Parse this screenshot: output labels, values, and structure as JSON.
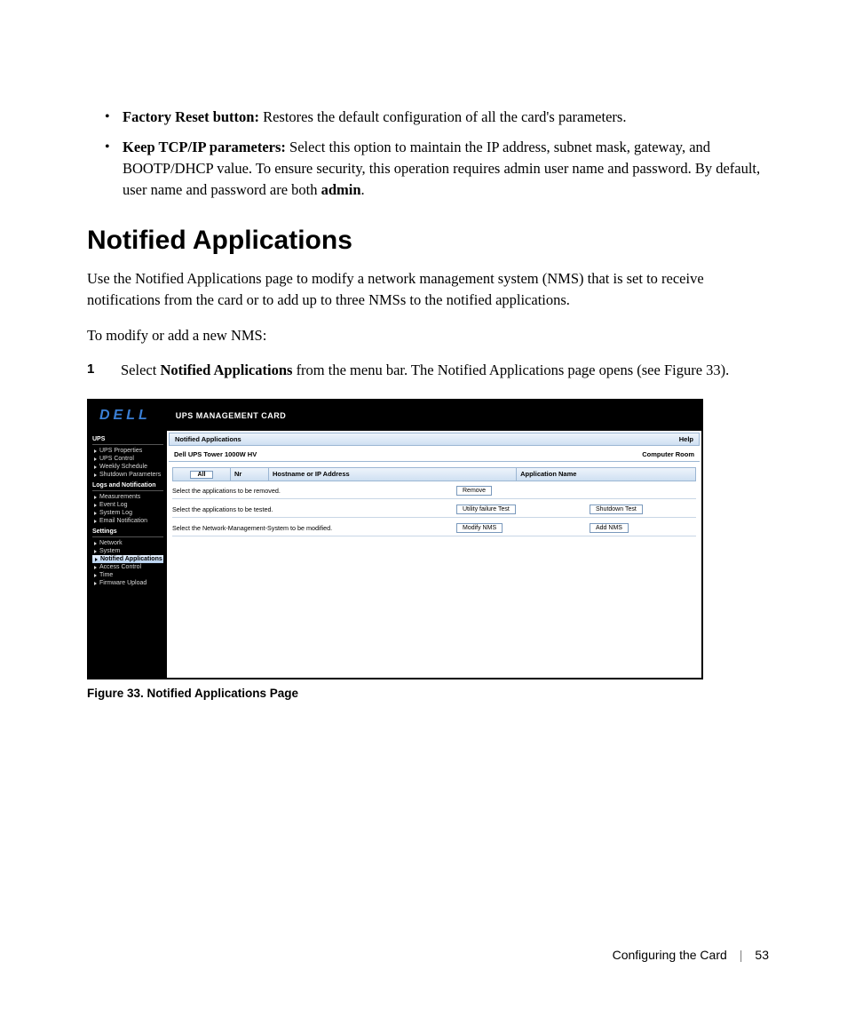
{
  "bullets": [
    {
      "label": "Factory Reset button:",
      "text": " Restores the default configuration of all the card's parameters."
    },
    {
      "label": "Keep TCP/IP parameters:",
      "text": " Select this option to maintain the IP address, subnet mask, gateway, and BOOTP/DHCP value. To ensure security, this operation requires admin user name and password. By default, user name and password are both ",
      "tail_bold": "admin",
      "tail_after": "."
    }
  ],
  "section_title": "Notified Applications",
  "para1": "Use the Notified Applications page to modify a network management system (NMS) that is set to receive notifications from the card or to add up to three NMSs to the notified applications.",
  "para2": "To modify or add a new NMS:",
  "step": {
    "num": "1",
    "pre": "Select ",
    "bold": "Notified Applications",
    "post": " from the menu bar. The Notified Applications page opens (see Figure 33)."
  },
  "figure": {
    "logo": "DELL",
    "header": "UPS MANAGEMENT CARD",
    "sidebar": {
      "cat1": "UPS",
      "items1": [
        "UPS Properties",
        "UPS Control",
        "Weekly Schedule",
        "Shutdown Parameters"
      ],
      "cat2": "Logs and Notification",
      "items2": [
        "Measurements",
        "Event Log",
        "System Log",
        "Email Notification"
      ],
      "cat3": "Settings",
      "items3_pre": [
        "Network",
        "System"
      ],
      "item_active": "Notified Applications",
      "items3_post": [
        "Access Control",
        "Time",
        "Firmware Upload"
      ]
    },
    "content": {
      "title": "Notified Applications",
      "help": "Help",
      "device": "Dell UPS Tower 1000W HV",
      "room": "Computer Room",
      "th_all": "All",
      "th_nr": "Nr",
      "th_host": "Hostname or IP Address",
      "th_app": "Application Name",
      "rows": [
        {
          "label": "Select the applications to be removed.",
          "btn1": "Remove",
          "btn2": ""
        },
        {
          "label": "Select the applications to be tested.",
          "btn1": "Utility failure Test",
          "btn2": "Shutdown Test"
        },
        {
          "label": "Select the Network-Management-System to be modified.",
          "btn1": "Modify NMS",
          "btn2": "Add NMS"
        }
      ]
    }
  },
  "caption": "Figure 33. Notified Applications Page",
  "footer": {
    "section": "Configuring the Card",
    "page": "53"
  }
}
